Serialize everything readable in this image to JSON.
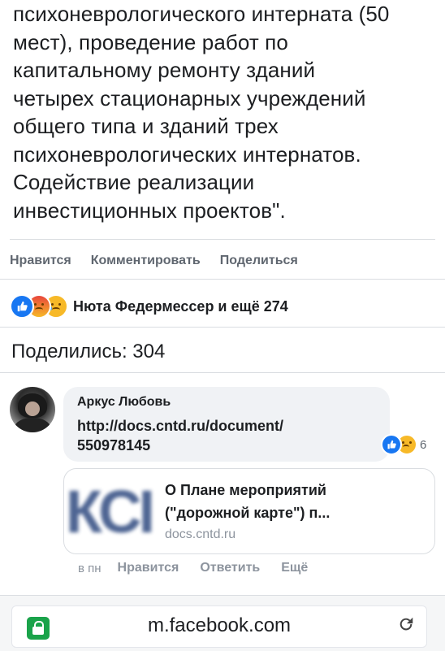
{
  "post": {
    "text_lines": [
      "психоневрологического интерната (50",
      "мест), проведение работ по",
      "капитальному ремонту зданий",
      "четырех стационарных учреждений",
      "общего типа и зданий трех",
      "психоневрологических интернатов.",
      "Содействие реализации",
      "инвестиционных проектов\"."
    ],
    "actions": {
      "like": "Нравится",
      "comment": "Комментировать",
      "share": "Поделиться"
    },
    "reactions": {
      "icons": [
        "like-icon",
        "angry-icon",
        "sad-icon"
      ],
      "names": "Нюта Федермессер и ещё 274"
    },
    "shares": "Поделились: 304"
  },
  "comment": {
    "author": "Аркус Любовь",
    "link_line1": "http://docs.cntd.ru/document/",
    "link_line2": "550978145",
    "reaction_count": "6",
    "preview": {
      "thumb_text": "КСІ",
      "title_line1": "О Плане мероприятий",
      "title_line2": "(\"дорожной карте\") п...",
      "domain": "docs.cntd.ru"
    },
    "time": "в пн",
    "actions": {
      "like": "Нравится",
      "reply": "Ответить",
      "more": "Ещё"
    }
  },
  "browser": {
    "url": "m.facebook.com",
    "icons": [
      "lock-icon",
      "reload-icon"
    ]
  },
  "colors": {
    "text": "#1c1e21",
    "muted": "#606770",
    "like_blue": "#1877f2",
    "secure_green": "#1aa34a"
  }
}
